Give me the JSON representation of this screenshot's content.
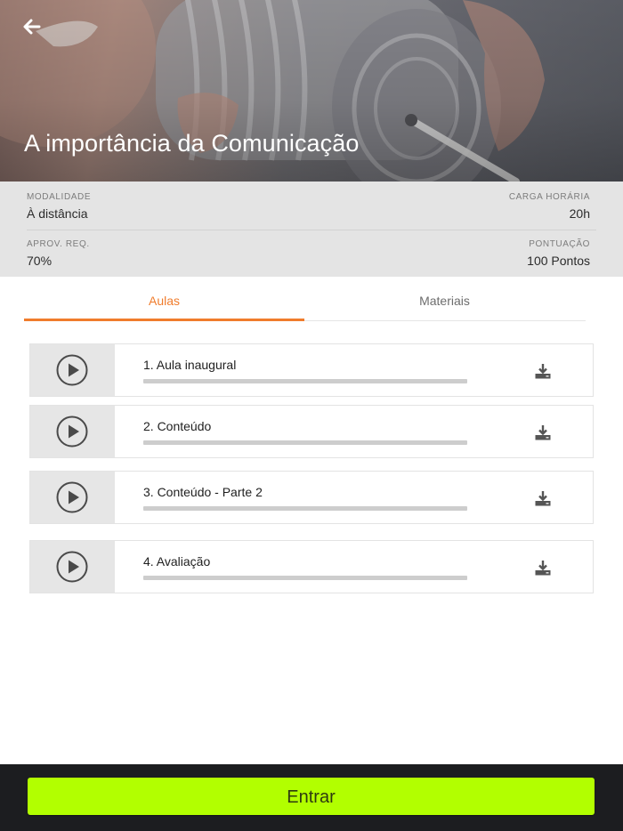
{
  "header": {
    "title": "A importância da Comunicação"
  },
  "info": {
    "modalidade": {
      "label": "MODALIDADE",
      "value": "À distância"
    },
    "carga_horaria": {
      "label": "CARGA HORÁRIA",
      "value": "20h"
    },
    "aprov_req": {
      "label": "APROV. REQ.",
      "value": "70%"
    },
    "pontuacao": {
      "label": "PONTUAÇÃO",
      "value": "100 Pontos"
    }
  },
  "tabs": [
    {
      "label": "Aulas"
    },
    {
      "label": "Materiais"
    }
  ],
  "lessons": [
    {
      "title": "1. Aula inaugural",
      "progress": 0
    },
    {
      "title": "2. Conteúdo",
      "progress": 0
    },
    {
      "title": "3. Conteúdo - Parte 2",
      "progress": 0
    },
    {
      "title": "4. Avaliação",
      "progress": 0
    }
  ],
  "footer": {
    "enter_label": "Entrar"
  },
  "colors": {
    "accent": "#f07c2c",
    "enter_button": "#b2ff00",
    "footer_bg": "#1c1d20",
    "info_bg": "#e4e4e4"
  },
  "icons": {
    "back": "arrow-left-icon",
    "play": "play-circle-icon",
    "download": "download-icon"
  }
}
